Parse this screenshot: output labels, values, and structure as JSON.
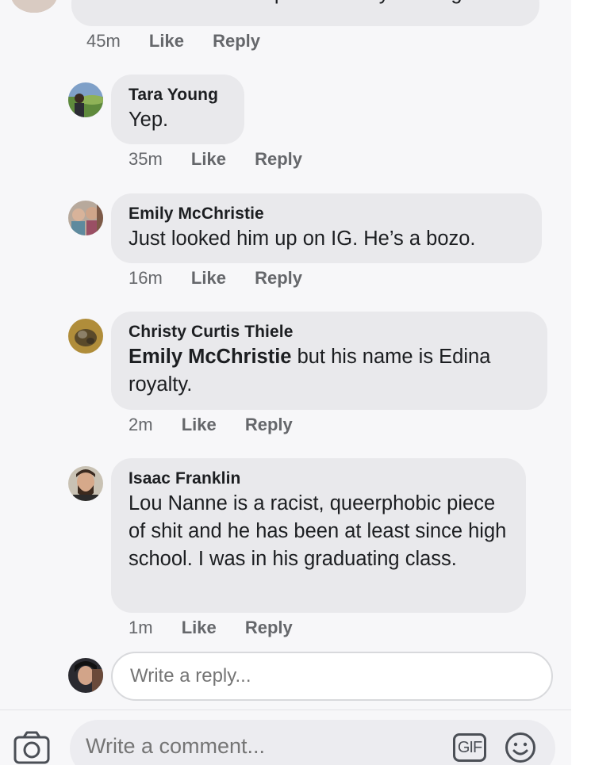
{
  "top_comment": {
    "text": "is someone in these photos really running?",
    "time": "45m",
    "like_label": "Like",
    "reply_label": "Reply"
  },
  "replies": [
    {
      "author": "Tara Young",
      "text": "Yep.",
      "time": "35m",
      "like_label": "Like",
      "reply_label": "Reply"
    },
    {
      "author": "Emily McChristie",
      "text": "Just looked him up on IG.  He’s a bozo.",
      "time": "16m",
      "like_label": "Like",
      "reply_label": "Reply"
    },
    {
      "author": "Christy Curtis Thiele",
      "mention": "Emily McChristie",
      "text": " but his name is Edina royalty.",
      "time": "2m",
      "like_label": "Like",
      "reply_label": "Reply"
    },
    {
      "author": "Isaac Franklin",
      "text": "Lou Nanne is a racist, queerphobic piece of shit and he has been at least since high school. I was in his graduating class.",
      "time": "1m",
      "like_label": "Like",
      "reply_label": "Reply"
    }
  ],
  "reply_input": {
    "placeholder": "Write a reply..."
  },
  "composer": {
    "placeholder": "Write a comment...",
    "gif_label": "GIF",
    "camera_icon": "camera-icon",
    "emoji_icon": "emoji-icon"
  },
  "colors": {
    "bubble": "#e9e9ec",
    "meta_text": "#65676b",
    "panel_bg": "#f7f7f9"
  }
}
